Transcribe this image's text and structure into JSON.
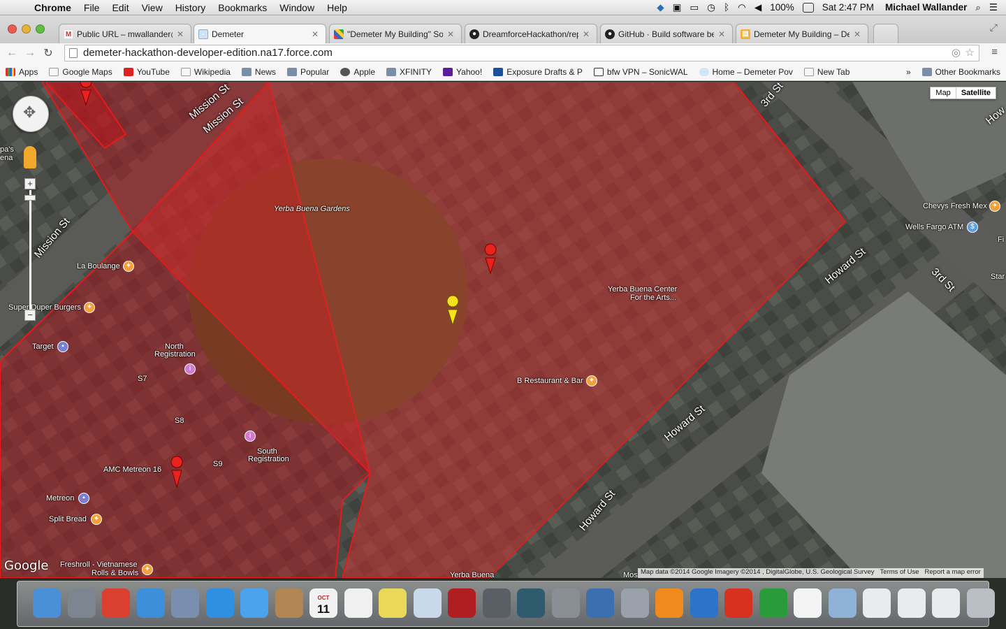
{
  "menubar": {
    "app": "Chrome",
    "menus": [
      "File",
      "Edit",
      "View",
      "History",
      "Bookmarks",
      "Window",
      "Help"
    ],
    "battery": "100%",
    "clock": "Sat 2:47 PM",
    "user": "Michael Wallander"
  },
  "tabs": [
    {
      "title": "Public URL – mwallander@",
      "favicon": "gmail-icon",
      "active": false
    },
    {
      "title": "Demeter",
      "favicon": "page-icon",
      "active": true
    },
    {
      "title": "\"Demeter My Building\" Sola",
      "favicon": "pinwheel-icon",
      "active": false
    },
    {
      "title": "DreamforceHackathon/rep",
      "favicon": "github-icon",
      "active": false
    },
    {
      "title": "GitHub · Build software be",
      "favicon": "github-icon",
      "active": false
    },
    {
      "title": "Demeter My Building – Der",
      "favicon": "doc-icon",
      "active": false
    }
  ],
  "address": "demeter-hackathon-developer-edition.na17.force.com",
  "bookmarks": [
    {
      "label": "Apps",
      "icon": "apps-grid-icon"
    },
    {
      "label": "Google Maps",
      "icon": "page-icon"
    },
    {
      "label": "YouTube",
      "icon": "youtube-icon"
    },
    {
      "label": "Wikipedia",
      "icon": "page-icon"
    },
    {
      "label": "News",
      "icon": "folder-icon"
    },
    {
      "label": "Popular",
      "icon": "folder-icon"
    },
    {
      "label": "Apple",
      "icon": "apple-icon"
    },
    {
      "label": "XFINITY",
      "icon": "folder-icon"
    },
    {
      "label": "Yahoo!",
      "icon": "yahoo-icon"
    },
    {
      "label": "Exposure Drafts & P",
      "icon": "pgb-icon"
    },
    {
      "label": "bfw VPN – SonicWAL",
      "icon": "sonicwall-icon"
    },
    {
      "label": "Home – Demeter Pov",
      "icon": "cloud-icon"
    },
    {
      "label": "New Tab",
      "icon": "page-icon"
    }
  ],
  "bookmarks_more": "»",
  "other_bookmarks": "Other Bookmarks",
  "map": {
    "type_buttons": {
      "map": "Map",
      "satellite": "Satellite"
    },
    "labels": {
      "yerba_gardens": "Yerba Buena Gardens",
      "la_boulange": "La Boulange",
      "super_duper": "Super Duper Burgers",
      "target": "Target",
      "north_reg_1": "North",
      "north_reg_2": "Registration",
      "south_reg_1": "South",
      "south_reg_2": "Registration",
      "amc": "AMC Metreon 16",
      "metreon": "Metreon",
      "split_bread": "Split Bread",
      "freshroll_1": "Freshroll - Vietnamese",
      "freshroll_2": "Rolls & Bowls",
      "b_restaurant": "B Restaurant & Bar",
      "ybca_1": "Yerba Buena Center",
      "ybca_2": "For the Arts...",
      "chevys": "Chevys Fresh Mex",
      "wells": "Wells Fargo ATM",
      "s7": "S7",
      "s8": "S8",
      "s9": "S9",
      "papas": "pa's",
      "ena": "ena",
      "star": "Star",
      "fi": "Fi",
      "yerba_bottom": "Yerba Buena",
      "mos": "Mos"
    },
    "streets": {
      "mission1": "Mission St",
      "mission2": "Mission St",
      "mission3": "Mission St",
      "third1": "3rd St",
      "third2": "3rd St",
      "howard1": "Howard St",
      "howard2": "Howard St",
      "howard3": "Howard St",
      "howard_tr": "How"
    },
    "logo": "Google",
    "footer": {
      "data": "Map data ©2014 Google Imagery ©2014 , DigitalGlobe, U.S. Geological Survey",
      "terms": "Terms of Use",
      "report": "Report a map error"
    },
    "overlay_color": "#c0141a"
  },
  "dock": [
    {
      "name": "finder-icon",
      "color": "#4b8fd6"
    },
    {
      "name": "launchpad-icon",
      "color": "#7d8590"
    },
    {
      "name": "chrome-icon",
      "color": "#d9402f"
    },
    {
      "name": "safari-icon",
      "color": "#3c8fd8"
    },
    {
      "name": "mail-stamp-icon",
      "color": "#7a8fb0"
    },
    {
      "name": "app-store-icon",
      "color": "#2f8fe0"
    },
    {
      "name": "messages-icon",
      "color": "#4aa3ec"
    },
    {
      "name": "contacts-icon",
      "color": "#b28652"
    },
    {
      "name": "calendar-icon",
      "color": "#f2f2f2"
    },
    {
      "name": "reminders-icon",
      "color": "#f0f0f0"
    },
    {
      "name": "stickies-icon",
      "color": "#e9d85a"
    },
    {
      "name": "preview-icon",
      "color": "#c9d8ea"
    },
    {
      "name": "photo-booth-icon",
      "color": "#b01e22"
    },
    {
      "name": "image-capture-icon",
      "color": "#5a5f66"
    },
    {
      "name": "time-machine-icon",
      "color": "#2e5c6e"
    },
    {
      "name": "system-preferences-icon",
      "color": "#8a8f96"
    },
    {
      "name": "hp-utility-icon",
      "color": "#3b6fb0"
    },
    {
      "name": "scanner-icon",
      "color": "#9aa1aa"
    },
    {
      "name": "ibooks-icon",
      "color": "#f08a1c"
    },
    {
      "name": "word-icon",
      "color": "#2b74c9"
    },
    {
      "name": "powerpoint-icon",
      "color": "#d6321f"
    },
    {
      "name": "excel-icon",
      "color": "#2a9a3a"
    },
    {
      "name": "document-icon",
      "color": "#f4f4f4"
    },
    {
      "name": "downloads-folder-icon",
      "color": "#8fb2d8"
    },
    {
      "name": "spreadsheet-file-icon",
      "color": "#e9ecef"
    },
    {
      "name": "spreadsheet-file-2-icon",
      "color": "#e9ecef"
    },
    {
      "name": "word-file-icon",
      "color": "#e9ecef"
    },
    {
      "name": "trash-icon",
      "color": "#b9bec4"
    }
  ],
  "dock_labels": {
    "calendar_month": "OCT",
    "calendar_day": "11"
  }
}
